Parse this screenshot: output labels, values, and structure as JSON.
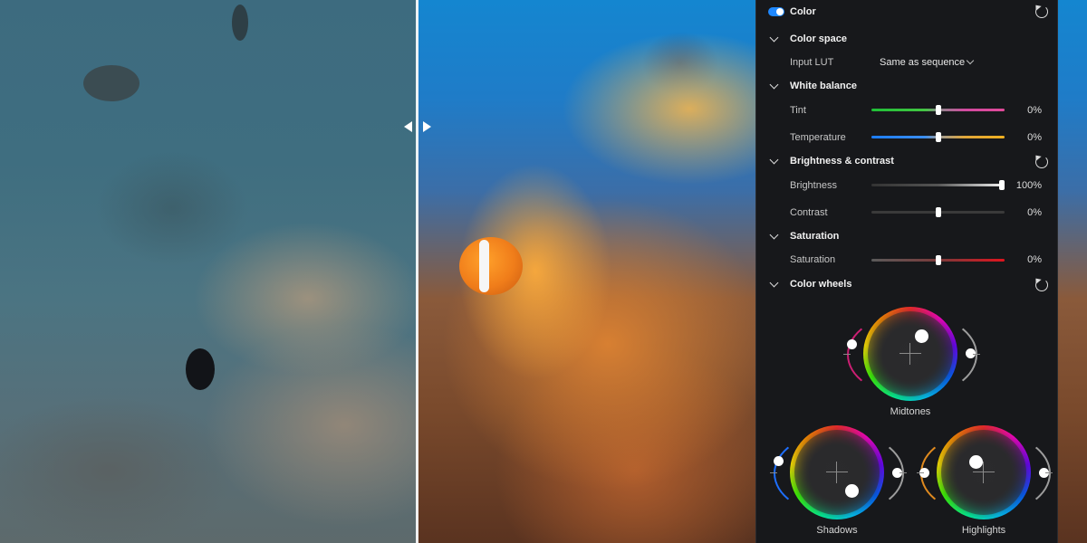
{
  "panel": {
    "header": {
      "title": "Color",
      "toggle_on": true
    },
    "color_space": {
      "title": "Color space",
      "input_lut_label": "Input LUT",
      "input_lut_value": "Same as sequence"
    },
    "white_balance": {
      "title": "White balance",
      "tint": {
        "label": "Tint",
        "value": "0%",
        "level": 0.5
      },
      "temperature": {
        "label": "Temperature",
        "value": "0%",
        "level": 0.5
      }
    },
    "brightness_contrast": {
      "title": "Brightness & contrast",
      "brightness": {
        "label": "Brightness",
        "value": "100%",
        "level": 1.0
      },
      "contrast": {
        "label": "Contrast",
        "value": "0%",
        "level": 0.5
      }
    },
    "saturation": {
      "title": "Saturation",
      "saturation": {
        "label": "Saturation",
        "value": "0%",
        "level": 0.5
      }
    },
    "color_wheels": {
      "title": "Color wheels",
      "midtones": "Midtones",
      "shadows": "Shadows",
      "highlights": "Highlights"
    }
  },
  "viewer": {
    "split_handle_icon": "left-right-arrows-icon",
    "accent_color": "#1e88ff"
  }
}
